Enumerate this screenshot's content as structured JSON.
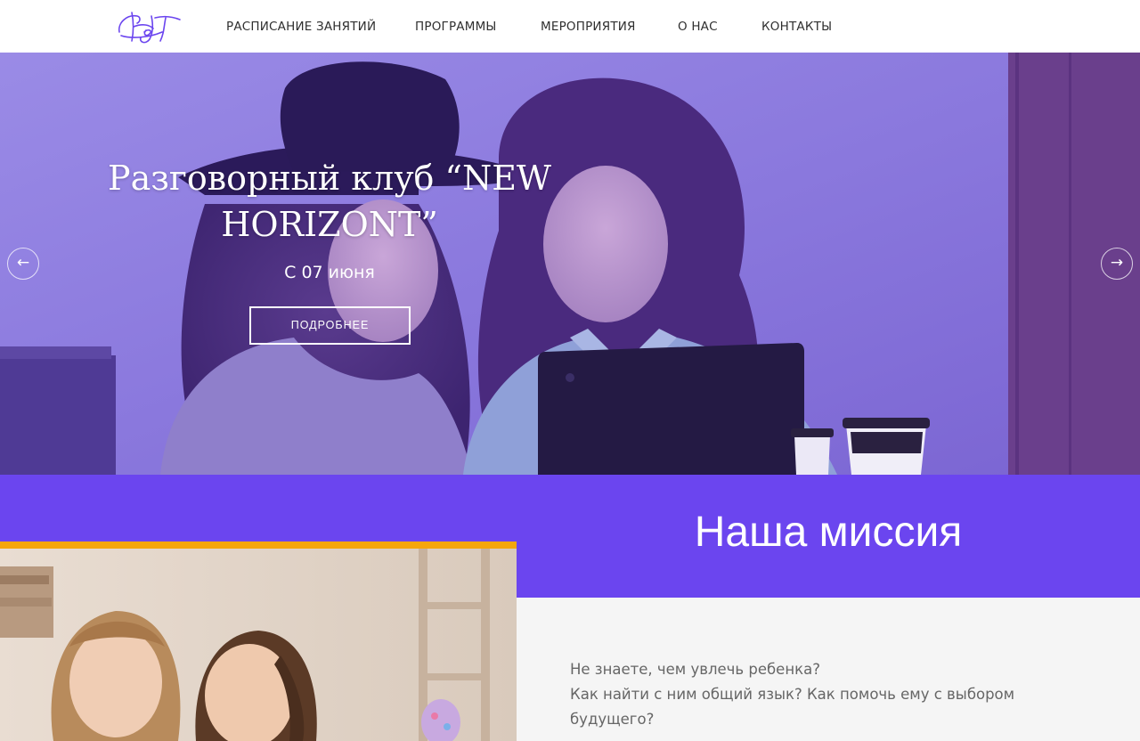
{
  "nav": {
    "items": [
      {
        "label": "РАСПИСАНИЕ ЗАНЯТИЙ"
      },
      {
        "label": "ПРОГРАММЫ"
      },
      {
        "label": "МЕРОПРИЯТИЯ"
      },
      {
        "label": "О НАС"
      },
      {
        "label": "КОНТАКТЫ"
      }
    ]
  },
  "hero": {
    "title_line1": "Разговорный клуб “NEW",
    "title_line2": "HORIZONT”",
    "date": "С 07 июня",
    "button_label": "ПОДРОБНЕЕ",
    "prev_icon": "arrow-left-icon",
    "next_icon": "arrow-right-icon"
  },
  "mission": {
    "title": "Наша миссия",
    "lines": [
      "Не знаете, чем увлечь ребенка?",
      "Как найти с ним общий язык? Как помочь ему с выбором",
      "будущего?"
    ]
  },
  "colors": {
    "brand_purple": "#6b45ef",
    "hero_overlay": "#7a5ee0",
    "accent_orange": "#f5a60c",
    "text_gray": "#666666"
  }
}
